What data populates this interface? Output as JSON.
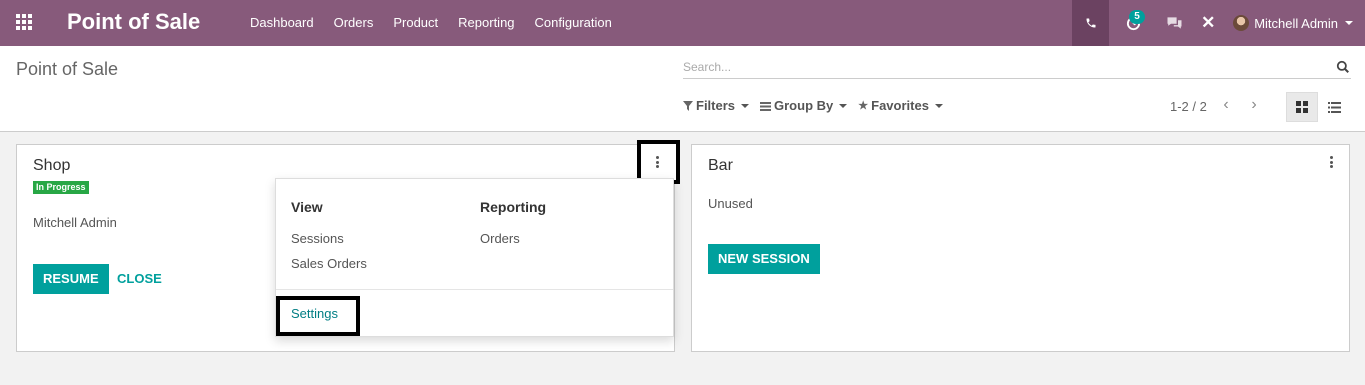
{
  "navbar": {
    "brand": "Point of Sale",
    "menu": [
      "Dashboard",
      "Orders",
      "Product",
      "Reporting",
      "Configuration"
    ],
    "activity_count": "5",
    "user_name": "Mitchell Admin"
  },
  "control_panel": {
    "title": "Point of Sale",
    "search_placeholder": "Search...",
    "filters_label": "Filters",
    "group_by_label": "Group By",
    "favorites_label": "Favorites",
    "pager": "1-2 / 2"
  },
  "cards": {
    "shop": {
      "title": "Shop",
      "status": "In Progress",
      "user": "Mitchell Admin",
      "resume_label": "RESUME",
      "close_label": "CLOSE"
    },
    "bar": {
      "title": "Bar",
      "state": "Unused",
      "new_session_label": "NEW SESSION"
    }
  },
  "dropdown": {
    "view_title": "View",
    "view_items": [
      "Sessions",
      "Sales Orders"
    ],
    "reporting_title": "Reporting",
    "reporting_items": [
      "Orders"
    ],
    "settings_label": "Settings"
  },
  "colors": {
    "navbar": "#875a7b",
    "accent": "#00a09d",
    "status_green": "#28a745"
  }
}
